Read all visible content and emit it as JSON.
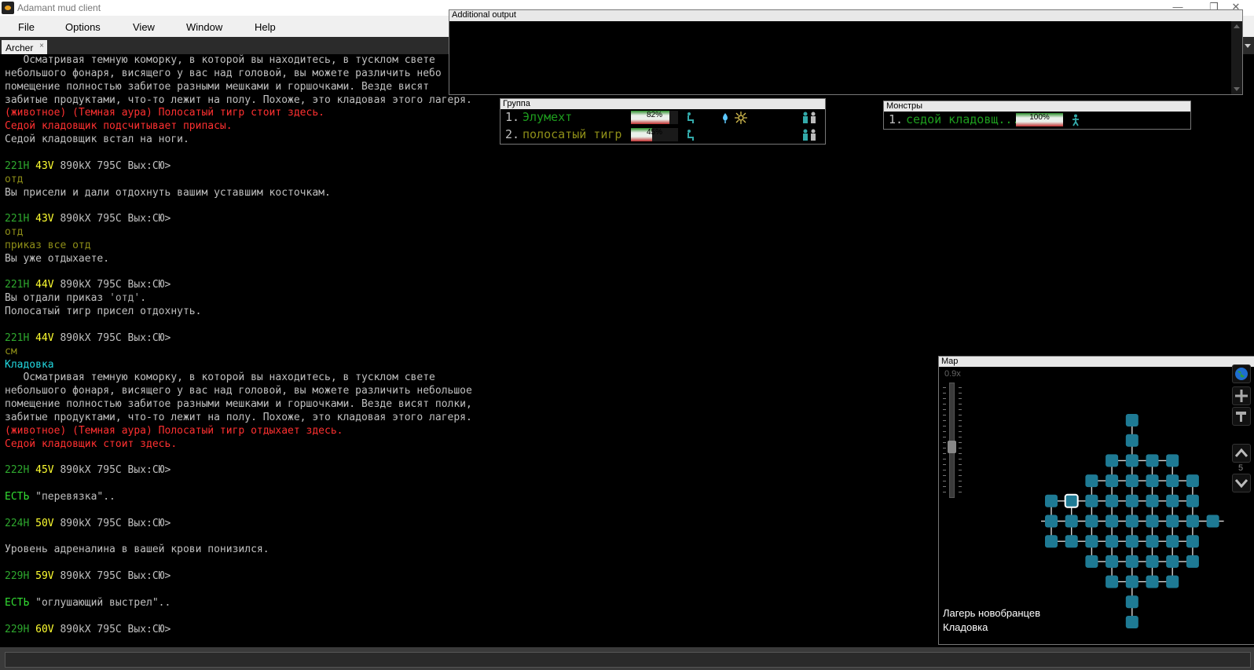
{
  "window": {
    "title": "Adamant mud client"
  },
  "menu": [
    "File",
    "Options",
    "View",
    "Window",
    "Help"
  ],
  "tab": {
    "label": "Archer",
    "close": "×"
  },
  "console": {
    "lines": [
      [
        [
          "text",
          "   Осматривая темную коморку, в которой вы находитесь, в тусклом свете"
        ]
      ],
      [
        [
          "text",
          "небольшого фонаря, висящего у вас над головой, вы можете различить небо"
        ]
      ],
      [
        [
          "text",
          "помещение полностью забитое разными мешками и горшочками. Везде висят"
        ]
      ],
      [
        [
          "text",
          "забитые продуктами, что-то лежит на полу. Похоже, это кладовая этого лагеря."
        ]
      ],
      [
        [
          "red",
          "(животное) (Темная аура) Полосатый тигр стоит здесь."
        ]
      ],
      [
        [
          "red",
          "Седой кладовщик подсчитывает припасы."
        ]
      ],
      [
        [
          "text",
          "Седой кладовщик встал на ноги."
        ]
      ],
      [],
      [
        [
          "hp",
          "221H"
        ],
        [
          "mv",
          " 43V"
        ],
        [
          "text",
          " 890kX 795C Вых:СЮ>"
        ]
      ],
      [
        [
          "cmd",
          "отд"
        ]
      ],
      [
        [
          "text",
          "Вы присели и дали отдохнуть вашим уставшим косточкам."
        ]
      ],
      [],
      [
        [
          "hp",
          "221H"
        ],
        [
          "mv",
          " 43V"
        ],
        [
          "text",
          " 890kX 795C Вых:СЮ>"
        ]
      ],
      [
        [
          "cmd",
          "отд"
        ]
      ],
      [
        [
          "cmd",
          "приказ все отд"
        ]
      ],
      [
        [
          "text",
          "Вы уже отдыхаете."
        ]
      ],
      [],
      [
        [
          "hp",
          "221H"
        ],
        [
          "mv",
          " 44V"
        ],
        [
          "text",
          " 890kX 795C Вых:СЮ>"
        ]
      ],
      [
        [
          "text",
          "Вы отдали приказ "
        ],
        [
          "gray",
          "'отд'"
        ],
        [
          "text",
          "."
        ]
      ],
      [
        [
          "text",
          "Полосатый тигр присел отдохнуть."
        ]
      ],
      [],
      [
        [
          "hp",
          "221H"
        ],
        [
          "mv",
          " 44V"
        ],
        [
          "text",
          " 890kX 795C Вых:СЮ>"
        ]
      ],
      [
        [
          "cmd",
          "см"
        ]
      ],
      [
        [
          "cyan",
          "Кладовка"
        ]
      ],
      [
        [
          "text",
          "   Осматривая темную коморку, в которой вы находитесь, в тусклом свете"
        ]
      ],
      [
        [
          "text",
          "небольшого фонаря, висящего у вас над головой, вы можете различить небольшое"
        ]
      ],
      [
        [
          "text",
          "помещение полностью забитое разными мешками и горшочками. Везде висят полки,"
        ]
      ],
      [
        [
          "text",
          "забитые продуктами, что-то лежит на полу. Похоже, это кладовая этого лагеря."
        ]
      ],
      [
        [
          "red",
          "(животное) (Темная аура) Полосатый тигр отдыхает здесь."
        ]
      ],
      [
        [
          "red",
          "Седой кладовщик стоит здесь."
        ]
      ],
      [],
      [
        [
          "hp",
          "222H"
        ],
        [
          "mv",
          " 45V"
        ],
        [
          "text",
          " 890kX 795C Вых:СЮ>"
        ]
      ],
      [],
      [
        [
          "grn",
          "ЕСТЬ"
        ],
        [
          "text",
          " \"перевязка\".."
        ]
      ],
      [],
      [
        [
          "hp",
          "224H"
        ],
        [
          "mv",
          " 50V"
        ],
        [
          "text",
          " 890kX 795C Вых:СЮ>"
        ]
      ],
      [],
      [
        [
          "text",
          "Уровень адреналина в вашей крови понизился."
        ]
      ],
      [],
      [
        [
          "hp",
          "229H"
        ],
        [
          "mv",
          " 59V"
        ],
        [
          "text",
          " 890kX 795C Вых:СЮ>"
        ]
      ],
      [],
      [
        [
          "grn",
          "ЕСТЬ"
        ],
        [
          "text",
          " \"оглушающий выстрел\".."
        ]
      ],
      [],
      [
        [
          "hp",
          "229H"
        ],
        [
          "mv",
          " 60V"
        ],
        [
          "text",
          " 890kX 795C Вых:СЮ>"
        ]
      ]
    ]
  },
  "additional_output": {
    "title": "Additional output"
  },
  "group": {
    "title": "Группа",
    "members": [
      {
        "num": "1.",
        "name": "Элумехт",
        "hp": "82%",
        "hp_fraction": 0.82,
        "name_color": "#1e9e1e"
      },
      {
        "num": "2.",
        "name": "полосатый тигр",
        "hp": "45%",
        "hp_fraction": 0.45,
        "name_color": "#8e8e18"
      }
    ]
  },
  "monsters": {
    "title": "Монстры",
    "members": [
      {
        "num": "1.",
        "name": "седой кладовщ...",
        "hp": "100%",
        "hp_fraction": 1.0,
        "name_color": "#1e9e1e"
      }
    ]
  },
  "map": {
    "title": "Map",
    "zoom": "0.9x",
    "level": "5",
    "area": "Лагерь новобранцев",
    "room": "Кладовка"
  },
  "colors": {
    "room": "#1e7a94",
    "room_current_border": "#ffffff",
    "connector": "#d8d8d8"
  }
}
